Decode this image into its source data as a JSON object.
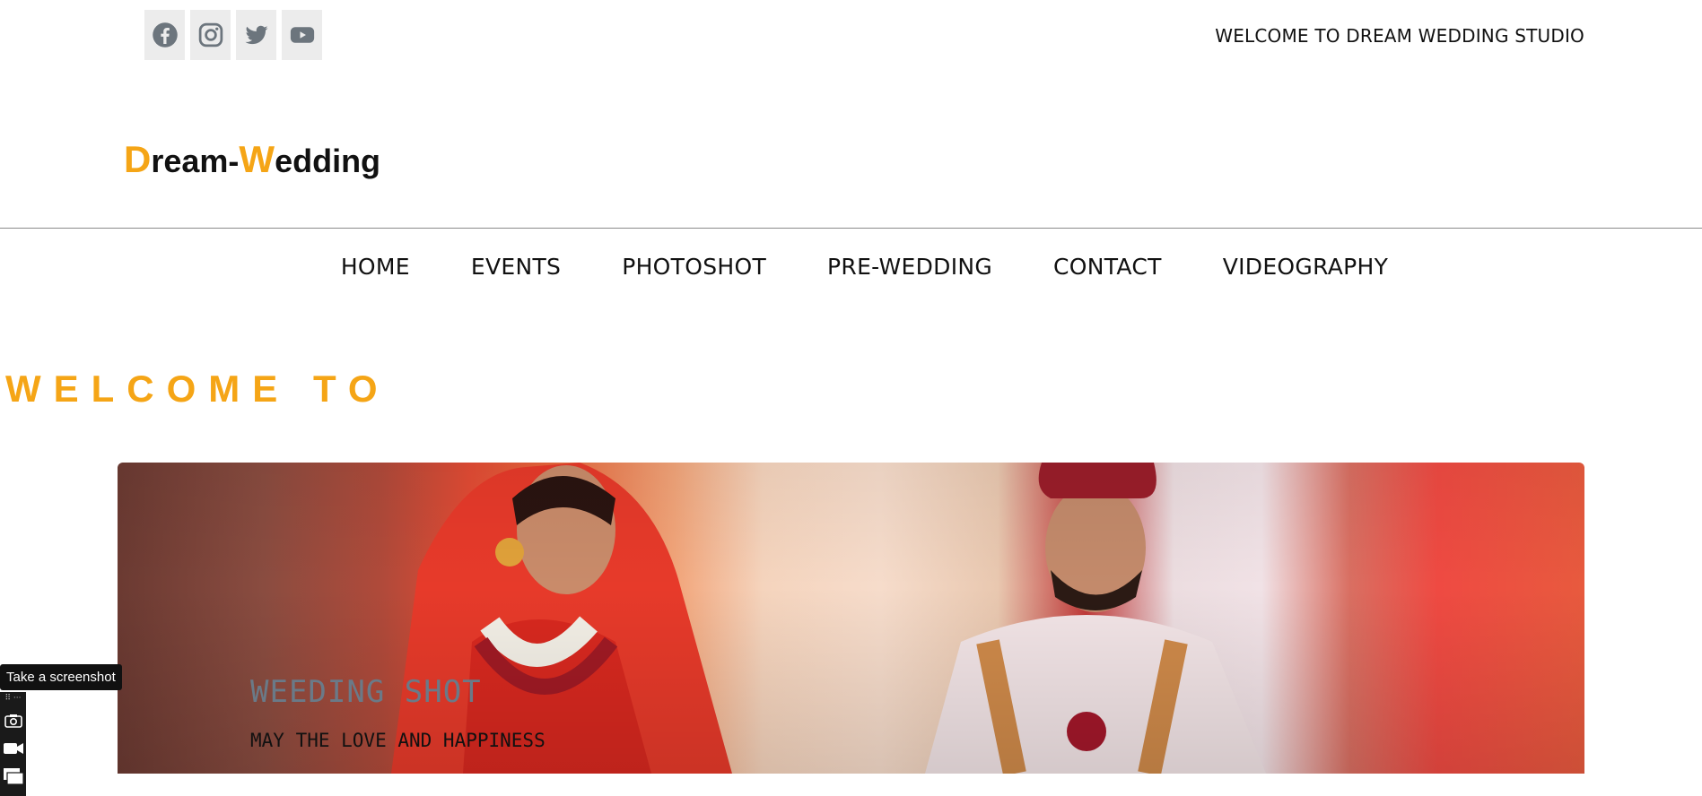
{
  "header": {
    "social": [
      {
        "name": "facebook-icon"
      },
      {
        "name": "instagram-icon"
      },
      {
        "name": "twitter-icon"
      },
      {
        "name": "youtube-icon"
      }
    ],
    "welcome_text": "WELCOME TO DREAM WEDDING STUDIO"
  },
  "logo": {
    "part1_letter": "D",
    "part1_rest": "ream-",
    "part2_letter": "W",
    "part2_rest": "edding"
  },
  "nav": {
    "items": [
      "HOME",
      "EVENTS",
      "PHOTOSHOT",
      "PRE-WEDDING",
      "CONTACT",
      "VIDEOGRAPHY"
    ]
  },
  "section": {
    "title": "WELCOME TO"
  },
  "hero": {
    "title": "WEEDING SHOT",
    "subtitle": "MAY THE LOVE AND HAPPINESS"
  },
  "overlay": {
    "tooltip": "Take a screenshot"
  },
  "colors": {
    "accent": "#f5a516",
    "icon_gray": "#6c757d"
  }
}
